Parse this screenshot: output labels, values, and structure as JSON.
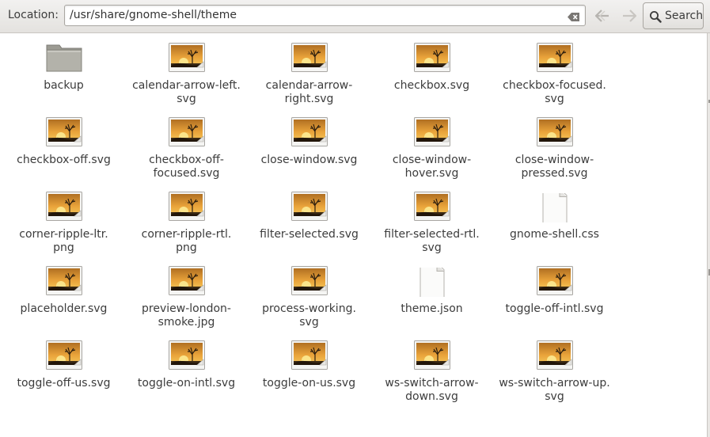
{
  "location_bar": {
    "label": "Location:",
    "path": "/usr/share/gnome-shell/theme",
    "search_label": "Search"
  },
  "files": [
    {
      "name": "backup",
      "icon": "folder-icon"
    },
    {
      "name": "calendar-arrow-left.\nsvg",
      "icon": "image-thumbnail-icon"
    },
    {
      "name": "calendar-arrow-\nright.svg",
      "icon": "image-thumbnail-icon"
    },
    {
      "name": "checkbox.svg",
      "icon": "image-thumbnail-icon"
    },
    {
      "name": "checkbox-focused.\nsvg",
      "icon": "image-thumbnail-icon"
    },
    {
      "name": "checkbox-off.svg",
      "icon": "image-thumbnail-icon"
    },
    {
      "name": "checkbox-off-\nfocused.svg",
      "icon": "image-thumbnail-icon"
    },
    {
      "name": "close-window.svg",
      "icon": "image-thumbnail-icon"
    },
    {
      "name": "close-window-\nhover.svg",
      "icon": "image-thumbnail-icon"
    },
    {
      "name": "close-window-\npressed.svg",
      "icon": "image-thumbnail-icon"
    },
    {
      "name": "corner-ripple-ltr.\npng",
      "icon": "image-thumbnail-icon"
    },
    {
      "name": "corner-ripple-rtl.\npng",
      "icon": "image-thumbnail-icon"
    },
    {
      "name": "filter-selected.svg",
      "icon": "image-thumbnail-icon"
    },
    {
      "name": "filter-selected-rtl.\nsvg",
      "icon": "image-thumbnail-icon"
    },
    {
      "name": "gnome-shell.css",
      "icon": "document-icon"
    },
    {
      "name": "placeholder.svg",
      "icon": "image-thumbnail-icon"
    },
    {
      "name": "preview-london-\nsmoke.jpg",
      "icon": "image-thumbnail-icon"
    },
    {
      "name": "process-working.\nsvg",
      "icon": "image-thumbnail-icon"
    },
    {
      "name": "theme.json",
      "icon": "document-icon"
    },
    {
      "name": "toggle-off-intl.svg",
      "icon": "image-thumbnail-icon"
    },
    {
      "name": "toggle-off-us.svg",
      "icon": "image-thumbnail-icon"
    },
    {
      "name": "toggle-on-intl.svg",
      "icon": "image-thumbnail-icon"
    },
    {
      "name": "toggle-on-us.svg",
      "icon": "image-thumbnail-icon"
    },
    {
      "name": "ws-switch-arrow-\ndown.svg",
      "icon": "image-thumbnail-icon"
    },
    {
      "name": "ws-switch-arrow-up.\nsvg",
      "icon": "image-thumbnail-icon"
    }
  ]
}
